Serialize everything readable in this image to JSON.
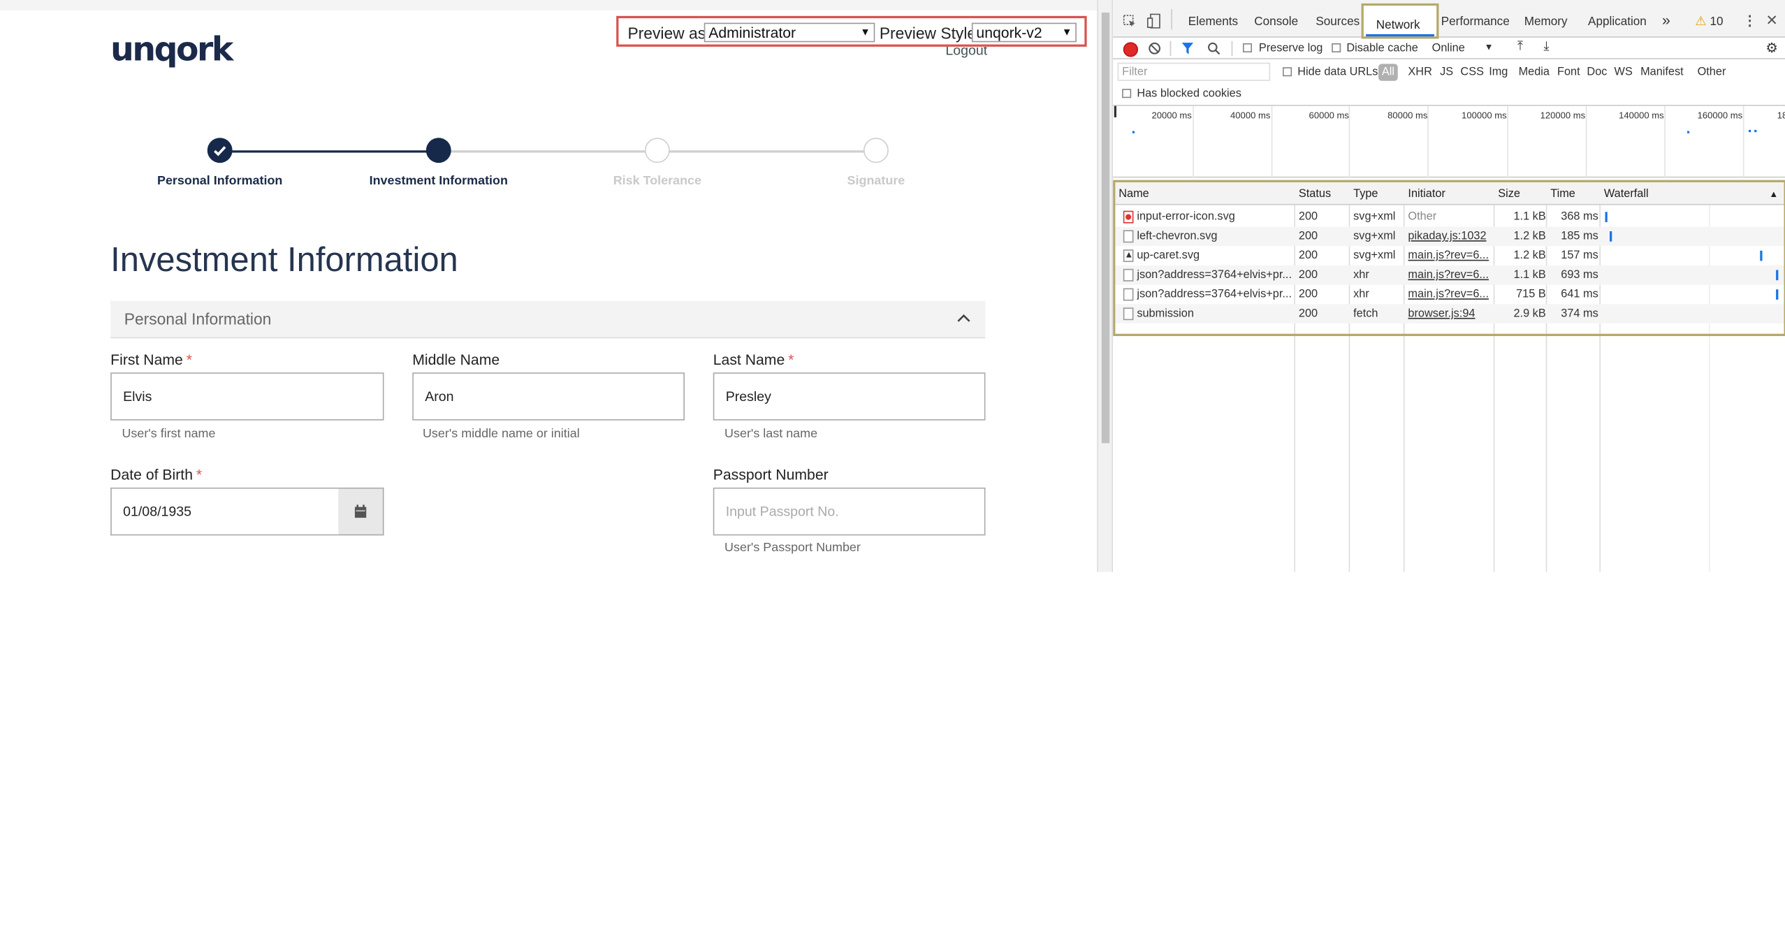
{
  "app": {
    "logo": "unqork",
    "logout": "Logout",
    "preview": {
      "as_label": "Preview as:",
      "as_value": "Administrator",
      "style_label": "Preview Style:",
      "style_value": "unqork-v2"
    },
    "steps": [
      {
        "label": "Personal Information",
        "state": "complete"
      },
      {
        "label": "Investment Information",
        "state": "current"
      },
      {
        "label": "Risk Tolerance",
        "state": "upcoming"
      },
      {
        "label": "Signature",
        "state": "upcoming"
      }
    ],
    "page_title": "Investment Information",
    "section_title": "Personal Information",
    "fields": {
      "first_name": {
        "label": "First Name",
        "value": "Elvis",
        "help": "User's first name",
        "required": "*"
      },
      "middle_name": {
        "label": "Middle Name",
        "value": "Aron",
        "help": "User's middle name or initial"
      },
      "last_name": {
        "label": "Last Name",
        "value": "Presley",
        "help": "User's last name",
        "required": "*"
      },
      "dob": {
        "label": "Date of Birth",
        "value": "01/08/1935",
        "required": "*"
      },
      "passport": {
        "label": "Passport Number",
        "placeholder": "Input Passport No.",
        "help": "User's Passport Number"
      }
    }
  },
  "devtools": {
    "tabs": [
      "Elements",
      "Console",
      "Sources",
      "Network",
      "Performance",
      "Memory",
      "Application"
    ],
    "active_tab": "Network",
    "more_tabs": "»",
    "warnings": "10",
    "toolbar": {
      "preserve_log": "Preserve log",
      "disable_cache": "Disable cache",
      "throttle": "Online"
    },
    "filter": {
      "placeholder": "Filter",
      "hide_data_urls": "Hide data URLs",
      "types": [
        "All",
        "XHR",
        "JS",
        "CSS",
        "Img",
        "Media",
        "Font",
        "Doc",
        "WS",
        "Manifest",
        "Other"
      ],
      "has_blocked_cookies": "Has blocked cookies"
    },
    "timeline_ticks": [
      "20000 ms",
      "40000 ms",
      "60000 ms",
      "80000 ms",
      "100000 ms",
      "120000 ms",
      "140000 ms",
      "160000 ms",
      "18"
    ],
    "columns": [
      "Name",
      "Status",
      "Type",
      "Initiator",
      "Size",
      "Time",
      "Waterfall"
    ],
    "requests": [
      {
        "name": "input-error-icon.svg",
        "status": "200",
        "type": "svg+xml",
        "initiator": "Other",
        "size": "1.1 kB",
        "time": "368 ms"
      },
      {
        "name": "left-chevron.svg",
        "status": "200",
        "type": "svg+xml",
        "initiator": "pikaday.js:1032",
        "size": "1.2 kB",
        "time": "185 ms"
      },
      {
        "name": "up-caret.svg",
        "status": "200",
        "type": "svg+xml",
        "initiator": "main.js?rev=6...",
        "size": "1.2 kB",
        "time": "157 ms"
      },
      {
        "name": "json?address=3764+elvis+pr...",
        "status": "200",
        "type": "xhr",
        "initiator": "main.js?rev=6...",
        "size": "1.1 kB",
        "time": "693 ms"
      },
      {
        "name": "json?address=3764+elvis+pr...",
        "status": "200",
        "type": "xhr",
        "initiator": "main.js?rev=6...",
        "size": "715 B",
        "time": "641 ms"
      },
      {
        "name": "submission",
        "status": "200",
        "type": "fetch",
        "initiator": "browser.js:94",
        "size": "2.9 kB",
        "time": "374 ms"
      }
    ]
  }
}
